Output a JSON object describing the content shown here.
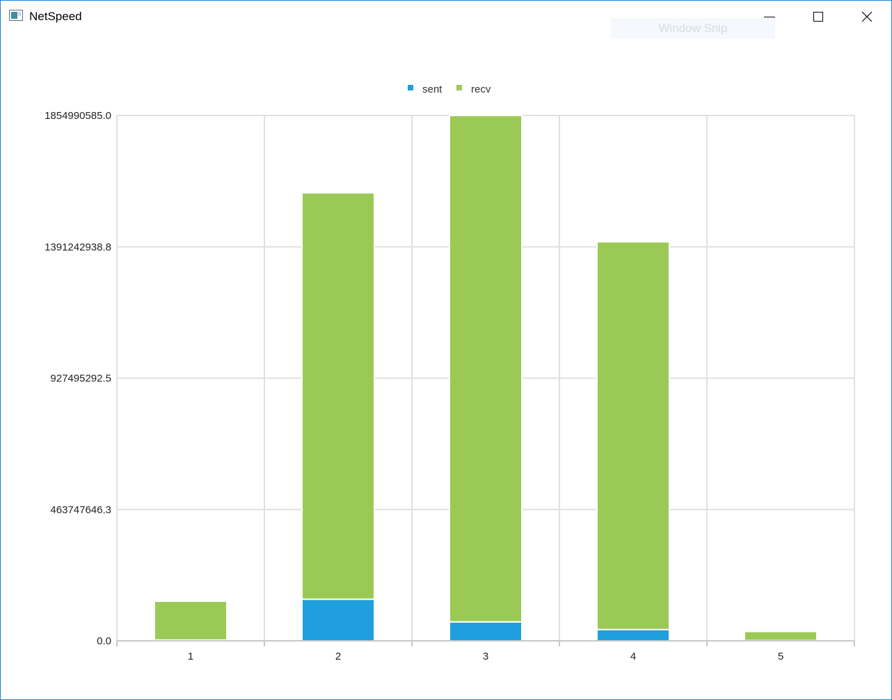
{
  "window": {
    "title": "NetSpeed",
    "overlay_label": "Window Snip"
  },
  "chart_data": {
    "type": "bar",
    "stacked": true,
    "categories": [
      "1",
      "2",
      "3",
      "4",
      "5"
    ],
    "series": [
      {
        "name": "sent",
        "color": "#1f9fde",
        "values": [
          3000000,
          147000000,
          67000000,
          40000000,
          1000000
        ]
      },
      {
        "name": "recv",
        "color": "#9aca55",
        "values": [
          137000000,
          1435000000,
          1788000000,
          1369000000,
          32000000
        ]
      }
    ],
    "y_ticks": [
      "1854990585.0",
      "1391242938.8",
      "927495292.5",
      "463747646.3",
      "0.0"
    ],
    "ylim": [
      0,
      1854990585.0
    ],
    "grid": true,
    "legend": "top-center"
  }
}
